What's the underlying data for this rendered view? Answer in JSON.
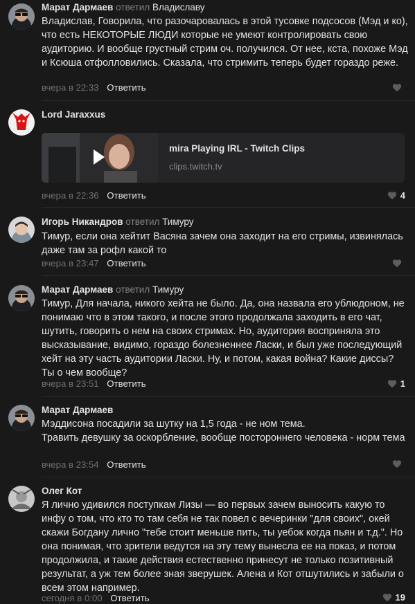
{
  "ui": {
    "reply_action": "Ответить",
    "replied_word": "ответил"
  },
  "comments": [
    {
      "author": "Марат Дармаев",
      "reply_to": "Владиславу",
      "text": "Владислав, Говорила, что разочаровалась в этой тусовке подсосов (Мэд и ко), что есть НЕКОТОРЫЕ ЛЮДИ которые не умеют контролировать свою аудиторию. И вообще грустный стрим оч. получился. От нее, кста, похоже Мэд и Ксюша отфолловились. Сказала, что стримить теперь будет гораздо реже.",
      "time": "вчера в 22:33",
      "likes": ""
    },
    {
      "author": "Lord Jaraxxus",
      "reply_to": "",
      "text": "",
      "time": "вчера в 22:36",
      "likes": "4",
      "link": {
        "title": "mira Playing IRL - Twitch Clips",
        "domain": "clips.twitch.tv"
      }
    },
    {
      "author": "Игорь Никандров",
      "reply_to": "Тимуру",
      "text": "Тимур, если она хейтит Васяна зачем она заходит на его стримы, извинялась даже там за рофл какой то",
      "time": "вчера в 23:47",
      "likes": ""
    },
    {
      "author": "Марат Дармаев",
      "reply_to": "Тимуру",
      "text": "Тимур, Для начала, никого хейта не было. Да, она назвала его ублюдоном, не понимаю что в этом такого, и после этого продолжала заходить в его чат, шутить, говорить о нем на своих стримах. Но, аудитория восприняла это высказывание, видимо, гораздо болезненнее Ласки, и был уже последующий хейт на эту часть аудитории Ласки. Ну, и потом, какая война? Какие диссы? Ты о чем вообще?",
      "time": "вчера в 23:51",
      "likes": "1"
    },
    {
      "author": "Марат Дармаев",
      "reply_to": "",
      "text_lines": [
        "Мэддисона посадили за шутку на 1,5 года - не ном тема.",
        "Травить девушку за оскорбление, вообще постороннего человека - норм тема"
      ],
      "time": "вчера в 23:54",
      "likes": ""
    },
    {
      "author": "Олег Кот",
      "reply_to": "",
      "text": "Я лично удивился поступкам Лизы — во первых зачем выносить какую то инфу о том, что кто то там себя не так повел с вечеринки \"для своих\", окей скажи Богдану лично \"тебе стоит меньше пить, ты уебок когда пьян и т.д.\". Но она понимая, что зрители ведутся на эту тему вынесла ее на показ, и потом продолжила, и такие действия естественно принесут не только позитивный результат, а уж тем более зная зверушек. Алена и Кот отшутились и забыли о всем этом например.",
      "time": "сегодня в 0:00",
      "likes": "19"
    }
  ]
}
